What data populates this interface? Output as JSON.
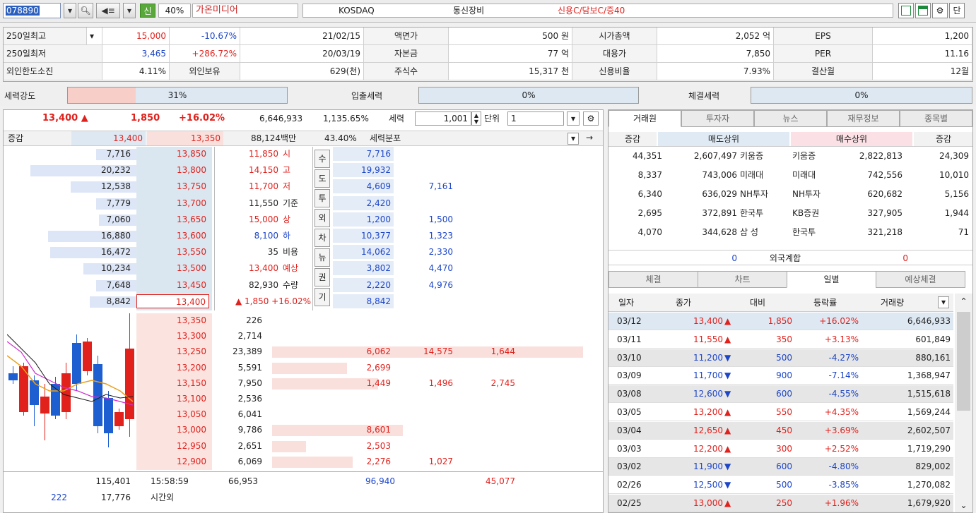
{
  "toolbar": {
    "code": "078890",
    "shin_label": "신",
    "margin_rate": "40%",
    "stock_name": "가온미디어",
    "market": "KOSDAQ",
    "sector": "통신장비",
    "credit_info": "신용C/담보C/증40",
    "last_btn": "단"
  },
  "summary": {
    "r1": {
      "l1": "250일최고",
      "v1": "15,000",
      "v2": "-10.67%",
      "v3": "21/02/15",
      "l2": "액면가",
      "v4": "500 원",
      "l3": "시가총액",
      "v5": "2,052 억",
      "l4": "EPS",
      "v6": "1,200"
    },
    "r2": {
      "l1": "250일최저",
      "v1": "3,465",
      "v2": "+286.72%",
      "v3": "20/03/19",
      "l2": "자본금",
      "v4": "77 억",
      "l3": "대용가",
      "v5": "7,850",
      "l4": "PER",
      "v6": "11.16"
    },
    "r3": {
      "l1": "외인한도소진",
      "v1": "4.11%",
      "l2a": "외인보유",
      "v3": "629(천)",
      "l2": "주식수",
      "v4": "15,317 천",
      "l3": "신용비율",
      "v5": "7.93%",
      "l4": "결산월",
      "v6": "12월"
    }
  },
  "strength": {
    "l1": "세력강도",
    "v1": "31%",
    "l2": "입출세력",
    "v2": "0%",
    "l3": "체결세력",
    "v3": "0%"
  },
  "quote": {
    "price": "13,400 ▲",
    "change": "1,850",
    "rate": "+16.02%",
    "volume": "6,646,933",
    "turnover": "1,135.65%",
    "seryeok_label": "세력",
    "seryeok_val": "1,001",
    "unit_label": "단위",
    "unit_val": "1",
    "h_change": "증감",
    "h_p1": "13,400",
    "h_p2": "13,350",
    "h_amt": "88,124백만",
    "h_pct": "43.40%",
    "h_dist": "세력분포"
  },
  "asks": [
    {
      "qty": "7,716",
      "price": "13,850",
      "bar": 0.38,
      "d1": "7,716",
      "d2": ""
    },
    {
      "qty": "20,232",
      "price": "13,800",
      "bar": 1.0,
      "d1": "19,932",
      "d2": ""
    },
    {
      "qty": "12,538",
      "price": "13,750",
      "bar": 0.62,
      "d1": "4,609",
      "d2": "7,161"
    },
    {
      "qty": "7,779",
      "price": "13,700",
      "bar": 0.38,
      "d1": "2,420",
      "d2": ""
    },
    {
      "qty": "7,060",
      "price": "13,650",
      "bar": 0.35,
      "d1": "1,200",
      "d2": "1,500"
    },
    {
      "qty": "16,880",
      "price": "13,600",
      "bar": 0.83,
      "d1": "10,377",
      "d2": "1,323"
    },
    {
      "qty": "16,472",
      "price": "13,550",
      "bar": 0.81,
      "d1": "14,062",
      "d2": "2,330"
    },
    {
      "qty": "10,234",
      "price": "13,500",
      "bar": 0.5,
      "d1": "3,802",
      "d2": "4,470"
    },
    {
      "qty": "7,648",
      "price": "13,450",
      "bar": 0.38,
      "d1": "2,220",
      "d2": "4,976"
    },
    {
      "qty": "8,842",
      "price": "13,400",
      "bar": 0.44,
      "d1": "8,842",
      "d2": ""
    }
  ],
  "info_rows": [
    {
      "v": "11,850",
      "k": "시",
      "col": "red"
    },
    {
      "v": "14,150",
      "k": "고",
      "col": "red"
    },
    {
      "v": "11,700",
      "k": "저",
      "col": "red"
    },
    {
      "v": "11,550",
      "k": "기준",
      "col": "dark"
    },
    {
      "v": "15,000",
      "k": "상",
      "col": "red"
    },
    {
      "v": "8,100",
      "k": "하",
      "col": "blue"
    },
    {
      "v": "35",
      "k": "비용",
      "col": "dark"
    },
    {
      "v": "13,400",
      "k": "예상",
      "col": "red"
    },
    {
      "v": "82,930",
      "k": "수량",
      "col": "dark"
    },
    {
      "v": "▲ 1,850 +16.02%",
      "k": "",
      "col": "red"
    }
  ],
  "side_tabs": [
    "수",
    "도",
    "투",
    "외",
    "차",
    "뉴",
    "권",
    "기"
  ],
  "bids": [
    {
      "price": "13,350",
      "qty": "226",
      "a": "",
      "b": "",
      "c": "",
      "bar": 0
    },
    {
      "price": "13,300",
      "qty": "2,714",
      "a": "",
      "b": "",
      "c": "",
      "bar": 0
    },
    {
      "price": "13,250",
      "qty": "23,389",
      "a": "6,062",
      "b": "14,575",
      "c": "1,644",
      "bar": 1.0
    },
    {
      "price": "13,200",
      "qty": "5,591",
      "a": "2,699",
      "b": "",
      "c": "",
      "bar": 0.24
    },
    {
      "price": "13,150",
      "qty": "7,950",
      "a": "1,449",
      "b": "1,496",
      "c": "2,745",
      "bar": 0.34
    },
    {
      "price": "13,100",
      "qty": "2,536",
      "a": "",
      "b": "",
      "c": "",
      "bar": 0
    },
    {
      "price": "13,050",
      "qty": "6,041",
      "a": "",
      "b": "",
      "c": "",
      "bar": 0
    },
    {
      "price": "13,000",
      "qty": "9,786",
      "a": "8,601",
      "b": "",
      "c": "",
      "bar": 0.42
    },
    {
      "price": "12,950",
      "qty": "2,651",
      "a": "2,503",
      "b": "",
      "c": "",
      "bar": 0.11
    },
    {
      "price": "12,900",
      "qty": "6,069",
      "a": "2,276",
      "b": "1,027",
      "c": "",
      "bar": 0.26
    }
  ],
  "totals": {
    "ask_total": "115,401",
    "time": "15:58:59",
    "bid_total": "66,953",
    "t1": "96,940",
    "t2": "45,077",
    "after_l": "222",
    "after_q": "17,776",
    "after_label": "시간외"
  },
  "right": {
    "tabs": [
      "거래원",
      "투자자",
      "뉴스",
      "재무정보",
      "종목별"
    ],
    "broker_head": {
      "chg": "증감",
      "sell": "매도상위",
      "buy": "매수상위",
      "chg2": "증감"
    },
    "brokers": [
      {
        "c1": "44,351",
        "s": "2,607,497",
        "sn": "키움증",
        "bn": "키움증",
        "b": "2,822,813",
        "c2": "24,309"
      },
      {
        "c1": "8,337",
        "s": "743,006",
        "sn": "미래대",
        "bn": "미래대",
        "b": "742,556",
        "c2": "10,010"
      },
      {
        "c1": "6,340",
        "s": "636,029",
        "sn": "NH투자",
        "bn": "NH투자",
        "b": "620,682",
        "c2": "5,156"
      },
      {
        "c1": "2,695",
        "s": "372,891",
        "sn": "한국투",
        "bn": "KB증권",
        "b": "327,905",
        "c2": "1,944"
      },
      {
        "c1": "4,070",
        "s": "344,628",
        "sn": "삼  성",
        "bn": "한국투",
        "b": "321,218",
        "c2": "71"
      }
    ],
    "foreign": {
      "s": "0",
      "label": "외국계합",
      "b": "0"
    },
    "tabs2": [
      "체결",
      "차트",
      "일별",
      "예상체결"
    ],
    "daily_head": {
      "d": "일자",
      "p": "종가",
      "ch": "대비",
      "r": "등락률",
      "v": "거래량"
    },
    "daily": [
      {
        "d": "03/12",
        "p": "13,400",
        "dir": "up",
        "ch": "1,850",
        "r": "+16.02%",
        "v": "6,646,933"
      },
      {
        "d": "03/11",
        "p": "11,550",
        "dir": "up",
        "ch": "350",
        "r": "+3.13%",
        "v": "601,849"
      },
      {
        "d": "03/10",
        "p": "11,200",
        "dir": "down",
        "ch": "500",
        "r": "-4.27%",
        "v": "880,161"
      },
      {
        "d": "03/09",
        "p": "11,700",
        "dir": "down",
        "ch": "900",
        "r": "-7.14%",
        "v": "1,368,947"
      },
      {
        "d": "03/08",
        "p": "12,600",
        "dir": "down",
        "ch": "600",
        "r": "-4.55%",
        "v": "1,515,618"
      },
      {
        "d": "03/05",
        "p": "13,200",
        "dir": "up",
        "ch": "550",
        "r": "+4.35%",
        "v": "1,569,244"
      },
      {
        "d": "03/04",
        "p": "12,650",
        "dir": "up",
        "ch": "450",
        "r": "+3.69%",
        "v": "2,602,507"
      },
      {
        "d": "03/03",
        "p": "12,200",
        "dir": "up",
        "ch": "300",
        "r": "+2.52%",
        "v": "1,719,290"
      },
      {
        "d": "03/02",
        "p": "11,900",
        "dir": "down",
        "ch": "600",
        "r": "-4.80%",
        "v": "829,002"
      },
      {
        "d": "02/26",
        "p": "12,500",
        "dir": "down",
        "ch": "500",
        "r": "-3.85%",
        "v": "1,270,082"
      },
      {
        "d": "02/25",
        "p": "13,000",
        "dir": "up",
        "ch": "250",
        "r": "+1.96%",
        "v": "1,679,920"
      }
    ]
  },
  "colors": {
    "up": "#e0211c",
    "down": "#1d46c8",
    "panel_blue": "#dde6f6",
    "panel_red": "#fae0dc"
  }
}
